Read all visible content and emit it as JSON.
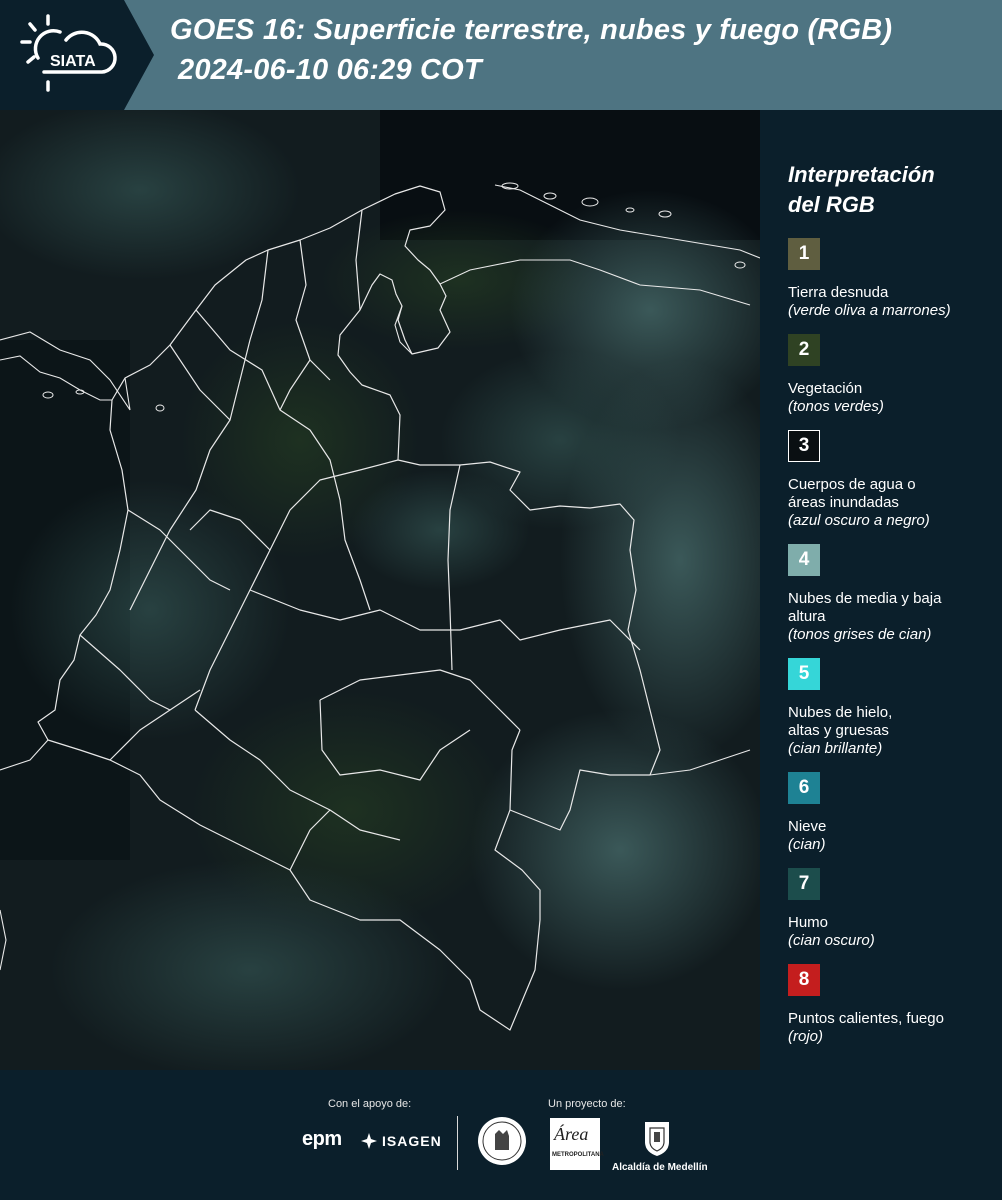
{
  "header": {
    "logo_text": "SIATA",
    "title_line1": "GOES 16: Superficie terrestre, nubes y fuego (RGB)",
    "title_line2": "2024-06-10 06:29 COT"
  },
  "legend": {
    "title_line1": "Interpretación",
    "title_line2": "del RGB",
    "items": [
      {
        "number": "1",
        "color": "#5f5e40",
        "label": "Tierra desnuda",
        "sub": "(verde oliva a marrones)"
      },
      {
        "number": "2",
        "color": "#2f4223",
        "label": "Vegetación",
        "sub": "(tonos verdes)"
      },
      {
        "number": "3",
        "color": "#0a0f12",
        "label": "Cuerpos de agua o áreas inundadas",
        "sub": "(azul oscuro a negro)"
      },
      {
        "number": "4",
        "color": "#7fadab",
        "label": "Nubes de media y baja altura",
        "sub": "(tonos grises de cian)"
      },
      {
        "number": "5",
        "color": "#35d6d8",
        "label": "Nubes de hielo, altas y gruesas",
        "sub": "(cian brillante)"
      },
      {
        "number": "6",
        "color": "#1e8294",
        "label": "Nieve",
        "sub": "(cian)"
      },
      {
        "number": "7",
        "color": "#1c4d4c",
        "label": "Humo",
        "sub": "(cian oscuro)"
      },
      {
        "number": "8",
        "color": "#c41e1e",
        "label": "Puntos calientes, fuego",
        "sub": "(rojo)"
      }
    ]
  },
  "footer": {
    "support_label": "Con el apoyo de:",
    "project_label": "Un proyecto de:",
    "epm": "epm",
    "isagen": "ISAGEN",
    "area_text": "Área",
    "area_sub": "METROPOLITANA",
    "medellin": "Alcaldía de Medellín"
  },
  "colors": {
    "header_band": "#4e7482",
    "background": "#0b1f2b",
    "border_lines": "#e8e8e8"
  }
}
